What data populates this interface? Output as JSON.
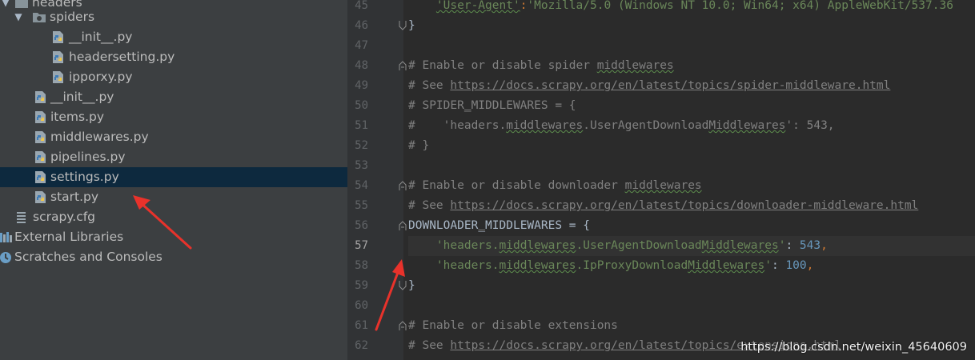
{
  "tree": {
    "items": [
      {
        "label": "headers",
        "icon": "folder-icon",
        "arrow": "▼"
      },
      {
        "label": "spiders",
        "icon": "folder-icon",
        "arrow": "▼"
      },
      {
        "label": "__init__.py",
        "icon": "python-file-icon"
      },
      {
        "label": "headersetting.py",
        "icon": "python-file-icon"
      },
      {
        "label": "ipporxy.py",
        "icon": "python-file-icon"
      },
      {
        "label": "__init__.py",
        "icon": "python-file-icon"
      },
      {
        "label": "items.py",
        "icon": "python-file-icon"
      },
      {
        "label": "middlewares.py",
        "icon": "python-file-icon"
      },
      {
        "label": "pipelines.py",
        "icon": "python-file-icon"
      },
      {
        "label": "settings.py",
        "icon": "python-file-icon",
        "selected": true
      },
      {
        "label": "start.py",
        "icon": "python-file-icon"
      },
      {
        "label": "scrapy.cfg",
        "icon": "config-file-icon"
      },
      {
        "label": "External Libraries",
        "icon": "libraries-icon"
      },
      {
        "label": "Scratches and Consoles",
        "icon": "scratches-icon"
      }
    ]
  },
  "editor": {
    "current_line": "57",
    "lines": [
      {
        "n": "45",
        "p1": "    ",
        "s1": "'User-Agent'",
        "p2": ":",
        "s2": "'Mozilla/5.0 (Windows NT 10.0; Win64; x64) AppleWebKit/537.36"
      },
      {
        "n": "46",
        "t": "}"
      },
      {
        "n": "47",
        "t": ""
      },
      {
        "n": "48",
        "c1": "# Enable or disable spider ",
        "w1": "middlewares"
      },
      {
        "n": "49",
        "c1": "# See ",
        "u1": "https://docs.scrapy.org/en/latest/topics/spider-middleware.html"
      },
      {
        "n": "50",
        "c1": "# SPIDER",
        "c2": "_",
        "c3": "MIDDLEWARES = {"
      },
      {
        "n": "51",
        "c1": "#    'headers.",
        "w1": "middlewares",
        "c2": ".UserAgentDownload",
        "w2": "Middlewares",
        "c3": "': 543,"
      },
      {
        "n": "52",
        "c1": "# }"
      },
      {
        "n": "53",
        "t": ""
      },
      {
        "n": "54",
        "c1": "# Enable or disable downloader ",
        "w1": "middlewares"
      },
      {
        "n": "55",
        "c1": "# See ",
        "u1": "https://docs.scrapy.org/en/latest/topics/downloader-middleware.html"
      },
      {
        "n": "56",
        "t1": "DOWNLOADER",
        "t2": "_",
        "t3": "MIDDLEWARES = {"
      },
      {
        "n": "57",
        "ind": "    ",
        "s1": "'headers.",
        "w1": "middlewares",
        "s2": ".UserAgentDownload",
        "w2": "Middlewares",
        "s3": "'",
        "p1": ": ",
        "num": "543",
        "p2": ","
      },
      {
        "n": "58",
        "ind": "    ",
        "s1": "'headers.",
        "w1": "middlewares",
        "s2": ".IpProxyDownload",
        "w2": "Middlewares",
        "s3": "'",
        "p1": ": ",
        "num": "100",
        "p2": ","
      },
      {
        "n": "59",
        "t": "}"
      },
      {
        "n": "60",
        "t": ""
      },
      {
        "n": "61",
        "c1": "# Enable or disable extensions"
      },
      {
        "n": "62",
        "c1": "# See ",
        "u1": "https://docs.scrapy.org/en/latest/topics/extensions.html"
      }
    ]
  },
  "watermark": "https://blog.csdn.net/weixin_45640609",
  "colors": {
    "tree_bg": "#3c3f41",
    "selected_bg": "#0d293e",
    "editor_bg": "#2b2b2b",
    "annotation_arrow": "#e8322b"
  }
}
